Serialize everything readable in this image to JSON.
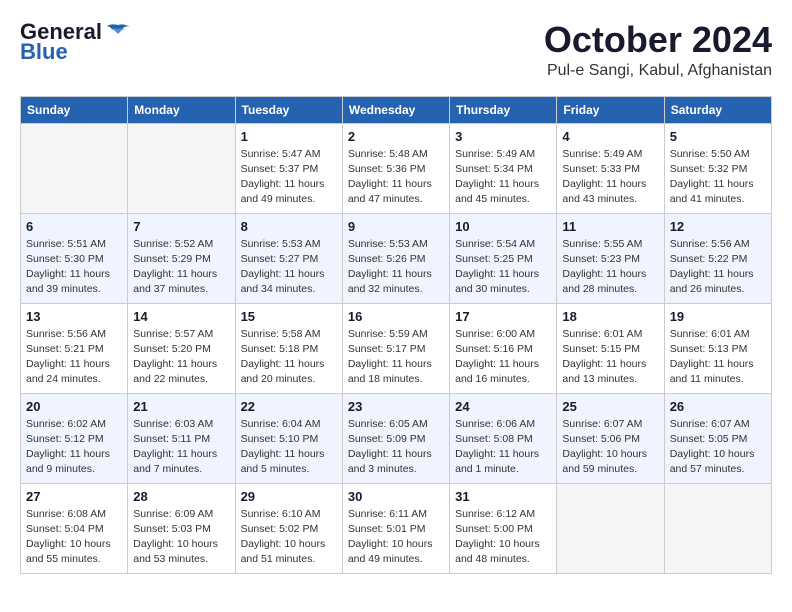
{
  "header": {
    "logo_line1": "General",
    "logo_line2": "Blue",
    "month_year": "October 2024",
    "location": "Pul-e Sangi, Kabul, Afghanistan"
  },
  "days_of_week": [
    "Sunday",
    "Monday",
    "Tuesday",
    "Wednesday",
    "Thursday",
    "Friday",
    "Saturday"
  ],
  "weeks": [
    [
      {
        "day": "",
        "info": ""
      },
      {
        "day": "",
        "info": ""
      },
      {
        "day": "1",
        "info": "Sunrise: 5:47 AM\nSunset: 5:37 PM\nDaylight: 11 hours and 49 minutes."
      },
      {
        "day": "2",
        "info": "Sunrise: 5:48 AM\nSunset: 5:36 PM\nDaylight: 11 hours and 47 minutes."
      },
      {
        "day": "3",
        "info": "Sunrise: 5:49 AM\nSunset: 5:34 PM\nDaylight: 11 hours and 45 minutes."
      },
      {
        "day": "4",
        "info": "Sunrise: 5:49 AM\nSunset: 5:33 PM\nDaylight: 11 hours and 43 minutes."
      },
      {
        "day": "5",
        "info": "Sunrise: 5:50 AM\nSunset: 5:32 PM\nDaylight: 11 hours and 41 minutes."
      }
    ],
    [
      {
        "day": "6",
        "info": "Sunrise: 5:51 AM\nSunset: 5:30 PM\nDaylight: 11 hours and 39 minutes."
      },
      {
        "day": "7",
        "info": "Sunrise: 5:52 AM\nSunset: 5:29 PM\nDaylight: 11 hours and 37 minutes."
      },
      {
        "day": "8",
        "info": "Sunrise: 5:53 AM\nSunset: 5:27 PM\nDaylight: 11 hours and 34 minutes."
      },
      {
        "day": "9",
        "info": "Sunrise: 5:53 AM\nSunset: 5:26 PM\nDaylight: 11 hours and 32 minutes."
      },
      {
        "day": "10",
        "info": "Sunrise: 5:54 AM\nSunset: 5:25 PM\nDaylight: 11 hours and 30 minutes."
      },
      {
        "day": "11",
        "info": "Sunrise: 5:55 AM\nSunset: 5:23 PM\nDaylight: 11 hours and 28 minutes."
      },
      {
        "day": "12",
        "info": "Sunrise: 5:56 AM\nSunset: 5:22 PM\nDaylight: 11 hours and 26 minutes."
      }
    ],
    [
      {
        "day": "13",
        "info": "Sunrise: 5:56 AM\nSunset: 5:21 PM\nDaylight: 11 hours and 24 minutes."
      },
      {
        "day": "14",
        "info": "Sunrise: 5:57 AM\nSunset: 5:20 PM\nDaylight: 11 hours and 22 minutes."
      },
      {
        "day": "15",
        "info": "Sunrise: 5:58 AM\nSunset: 5:18 PM\nDaylight: 11 hours and 20 minutes."
      },
      {
        "day": "16",
        "info": "Sunrise: 5:59 AM\nSunset: 5:17 PM\nDaylight: 11 hours and 18 minutes."
      },
      {
        "day": "17",
        "info": "Sunrise: 6:00 AM\nSunset: 5:16 PM\nDaylight: 11 hours and 16 minutes."
      },
      {
        "day": "18",
        "info": "Sunrise: 6:01 AM\nSunset: 5:15 PM\nDaylight: 11 hours and 13 minutes."
      },
      {
        "day": "19",
        "info": "Sunrise: 6:01 AM\nSunset: 5:13 PM\nDaylight: 11 hours and 11 minutes."
      }
    ],
    [
      {
        "day": "20",
        "info": "Sunrise: 6:02 AM\nSunset: 5:12 PM\nDaylight: 11 hours and 9 minutes."
      },
      {
        "day": "21",
        "info": "Sunrise: 6:03 AM\nSunset: 5:11 PM\nDaylight: 11 hours and 7 minutes."
      },
      {
        "day": "22",
        "info": "Sunrise: 6:04 AM\nSunset: 5:10 PM\nDaylight: 11 hours and 5 minutes."
      },
      {
        "day": "23",
        "info": "Sunrise: 6:05 AM\nSunset: 5:09 PM\nDaylight: 11 hours and 3 minutes."
      },
      {
        "day": "24",
        "info": "Sunrise: 6:06 AM\nSunset: 5:08 PM\nDaylight: 11 hours and 1 minute."
      },
      {
        "day": "25",
        "info": "Sunrise: 6:07 AM\nSunset: 5:06 PM\nDaylight: 10 hours and 59 minutes."
      },
      {
        "day": "26",
        "info": "Sunrise: 6:07 AM\nSunset: 5:05 PM\nDaylight: 10 hours and 57 minutes."
      }
    ],
    [
      {
        "day": "27",
        "info": "Sunrise: 6:08 AM\nSunset: 5:04 PM\nDaylight: 10 hours and 55 minutes."
      },
      {
        "day": "28",
        "info": "Sunrise: 6:09 AM\nSunset: 5:03 PM\nDaylight: 10 hours and 53 minutes."
      },
      {
        "day": "29",
        "info": "Sunrise: 6:10 AM\nSunset: 5:02 PM\nDaylight: 10 hours and 51 minutes."
      },
      {
        "day": "30",
        "info": "Sunrise: 6:11 AM\nSunset: 5:01 PM\nDaylight: 10 hours and 49 minutes."
      },
      {
        "day": "31",
        "info": "Sunrise: 6:12 AM\nSunset: 5:00 PM\nDaylight: 10 hours and 48 minutes."
      },
      {
        "day": "",
        "info": ""
      },
      {
        "day": "",
        "info": ""
      }
    ]
  ]
}
